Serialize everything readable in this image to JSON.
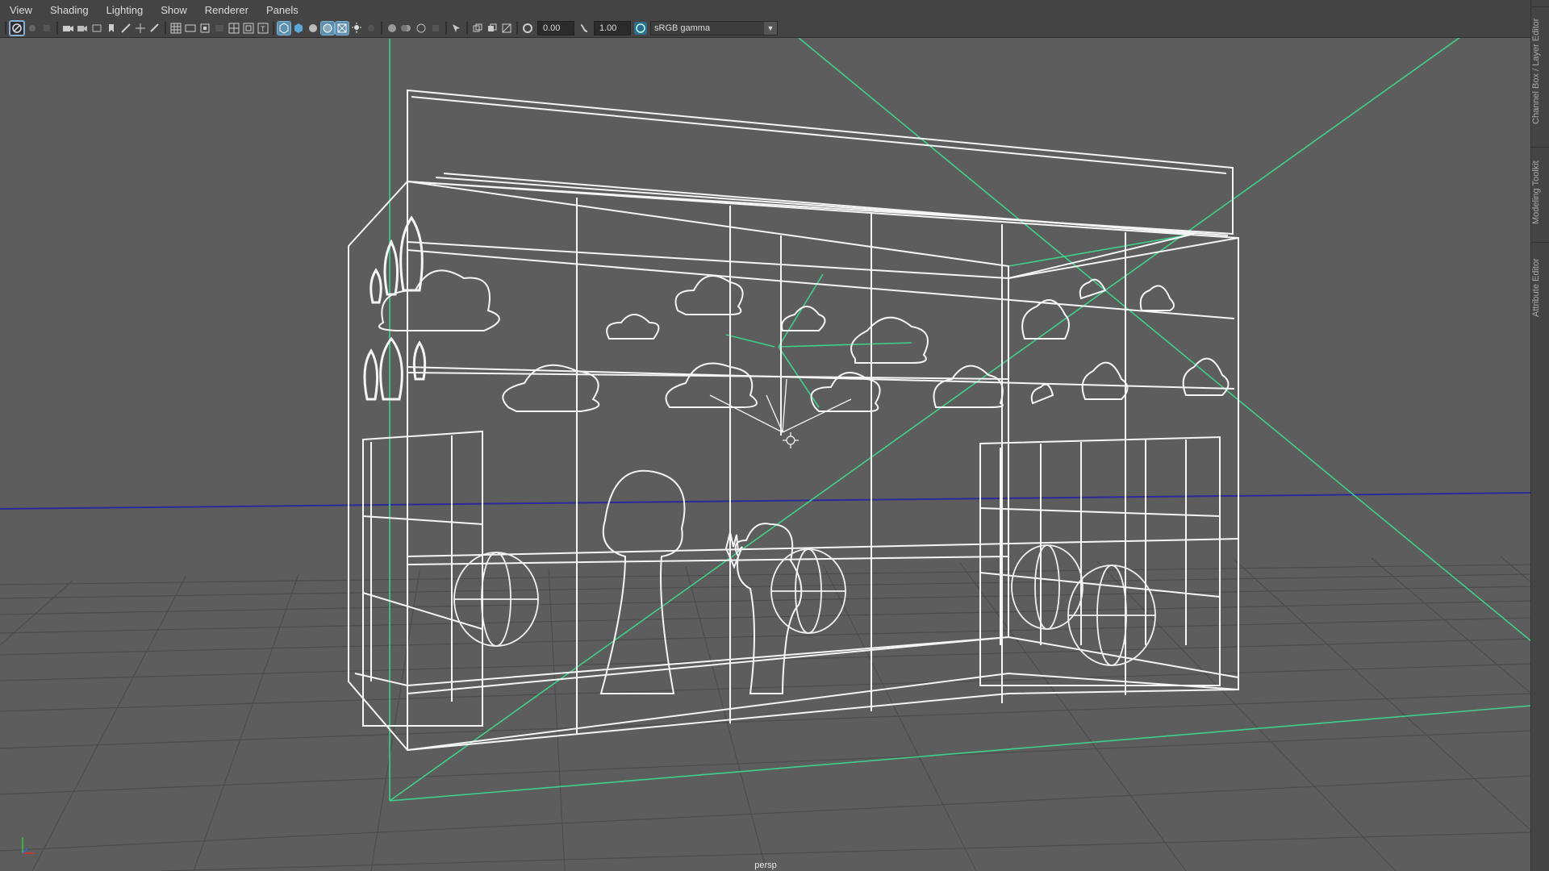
{
  "menubar": {
    "items": [
      "View",
      "Shading",
      "Lighting",
      "Show",
      "Renderer",
      "Panels"
    ]
  },
  "toolbar": {
    "exposure_value": "0.00",
    "gamma_value": "1.00",
    "color_space": "sRGB gamma"
  },
  "viewport": {
    "camera_label": "persp"
  },
  "right_dock": {
    "tabs": [
      "Channel Box / Layer Editor",
      "Modeling Toolkit",
      "Attribute Editor"
    ]
  },
  "colors": {
    "background": "#5d5d5d",
    "grid": "#4d4d4d",
    "wire": "#ffffff",
    "camera_frustum": "#3fd08a",
    "horizon": "#2222aa",
    "ui_panel": "#444444"
  }
}
